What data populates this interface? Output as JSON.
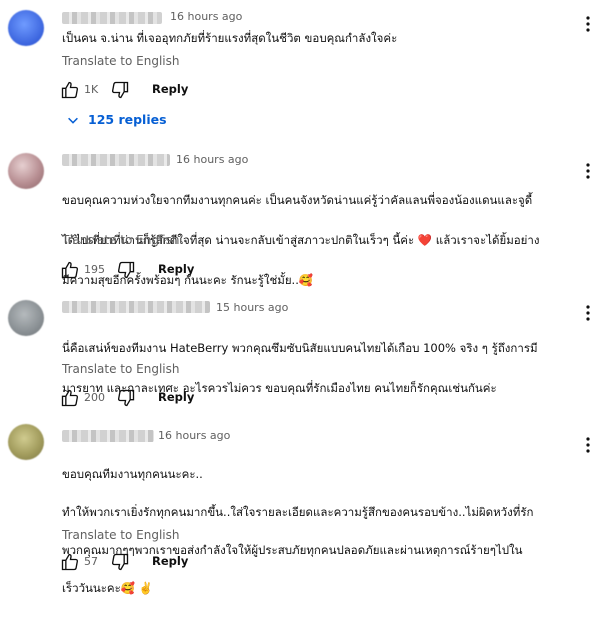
{
  "comments": [
    {
      "time": "16 hours ago",
      "text": "เป็นคน จ.น่าน ที่เจออุทกภัยที่ร้ายแรงที่สุดในชีวิต ขอบคุณกำลังใจค่ะ",
      "translate": "Translate to English",
      "likes": "1K",
      "reply": "Reply",
      "replies": "125 replies",
      "avatar_color": "#4d7cf0"
    },
    {
      "time": "16 hours ago",
      "text_lines": [
        "ขอบคุณความห่วงใยจากทีมงานทุกคนค่ะ เป็นคนจังหวัดน่านแค่รู้ว่าคัลแลนพี่จองน้องแดนและจูดี้",
        "ได้ไปเที่ยวที่น่านก็รู้สึกดีใจที่สุด น่านจะกลับเข้าสู่สภาวะปกติในเร็วๆ นี้ค่ะ ❤️ แล้วเราจะได้ยิ้มอย่าง",
        "มีความสุขอีกครั้งพร้อมๆ กันนะคะ รักนะรู้ใช่มั้ย..🥰"
      ],
      "translate": "Translate to English",
      "likes": "195",
      "reply": "Reply",
      "avatar_color": "#c7a7a9"
    },
    {
      "time": "15 hours ago",
      "text_lines": [
        "นี่คือเสน่ห์ของทีมงาน HateBerry พวกคุณซึมซับนิสัยแบบคนไทยได้เกือบ 100% จริง ๆ รู้ถึงการมี",
        "มารยาท และกาละเทศะ อะไรควรไม่ควร ขอบคุณที่รักเมืองไทย คนไทยก็รักคุณเช่นกันค่ะ"
      ],
      "translate": "Translate to English",
      "likes": "200",
      "reply": "Reply",
      "avatar_color": "#8e9498"
    },
    {
      "time": "16 hours ago",
      "text_lines": [
        "ขอบคุณทีมงานทุกคนนะคะ..",
        "ทำให้พวกเราเยิ่งรักทุกคนมากขึ้น..ใส่ใจรายละเอียดและความรู้สึกของคนรอบข้าง..ไม่ผิดหวังที่รัก",
        "พวกคุณมากๆๆพวกเราขอส่งกำลังใจให้ผู้ประสบภัยทุกคนปลอดภัยและผ่านเหตุการณ์ร้ายๆไปใน",
        "เร็ววันนะคะ🥰 ✌️"
      ],
      "translate": "Translate to English",
      "likes": "57",
      "reply": "Reply",
      "avatar_color": "#a8a266"
    }
  ]
}
